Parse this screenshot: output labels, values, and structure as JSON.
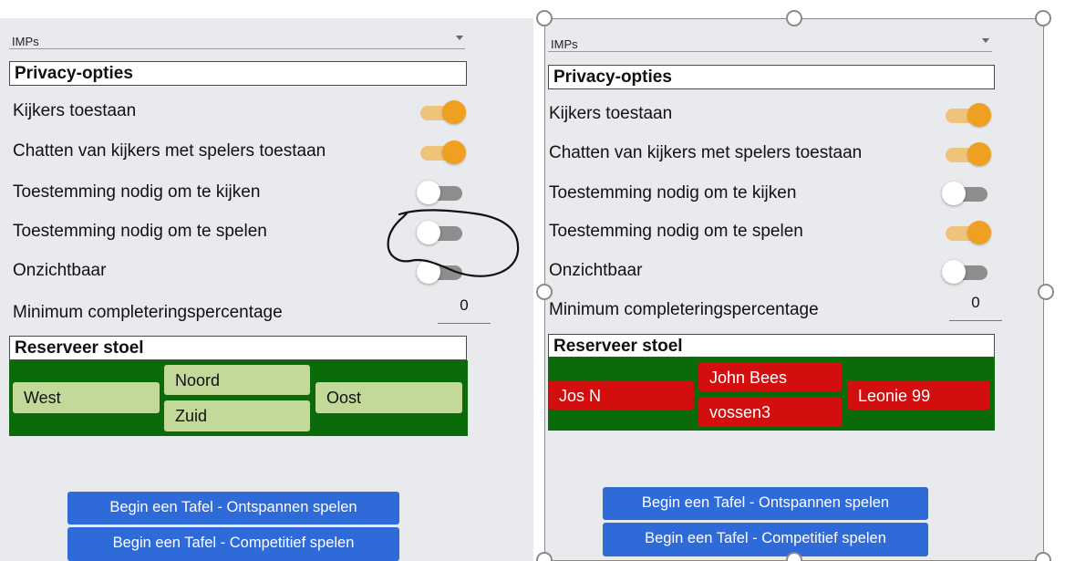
{
  "left": {
    "game_type": "IMPs",
    "privacy_title": "Privacy-opties",
    "options": [
      {
        "label": "Kijkers toestaan",
        "state": "on"
      },
      {
        "label": "Chatten van kijkers met spelers toestaan",
        "state": "on"
      },
      {
        "label": "Toestemming nodig om te kijken",
        "state": "off"
      },
      {
        "label": "Toestemming nodig om te spelen",
        "state": "off"
      },
      {
        "label": "Onzichtbaar",
        "state": "off"
      }
    ],
    "min_label": "Minimum completeringspercentage",
    "min_value": "0",
    "seat_title": "Reserveer stoel",
    "seats": {
      "west": "West",
      "north": "Noord",
      "south": "Zuid",
      "east": "Oost"
    },
    "buttons": {
      "relaxed": "Begin een Tafel - Ontspannen spelen",
      "competitive": "Begin een Tafel - Competitief spelen"
    }
  },
  "right": {
    "game_type": "IMPs",
    "privacy_title": "Privacy-opties",
    "options": [
      {
        "label": "Kijkers toestaan",
        "state": "on"
      },
      {
        "label": "Chatten van kijkers met spelers toestaan",
        "state": "on"
      },
      {
        "label": "Toestemming nodig om te kijken",
        "state": "off"
      },
      {
        "label": "Toestemming nodig om te spelen",
        "state": "on"
      },
      {
        "label": "Onzichtbaar",
        "state": "off"
      }
    ],
    "min_label": "Minimum completeringspercentage",
    "min_value": "0",
    "seat_title": "Reserveer stoel",
    "seats": {
      "west": "Jos N",
      "north": "John Bees",
      "south": "vossen3",
      "east": "Leonie 99"
    },
    "buttons": {
      "relaxed": "Begin een Tafel - Ontspannen spelen",
      "competitive": "Begin een Tafel - Competitief spelen"
    }
  },
  "colors": {
    "panel_bg": "#e8eaed",
    "toggle_on": "#f0a020",
    "seat_area": "#0b6b0b",
    "seat_free": "#c3d99a",
    "seat_taken": "#d30e0e",
    "button": "#2f6ad9"
  }
}
